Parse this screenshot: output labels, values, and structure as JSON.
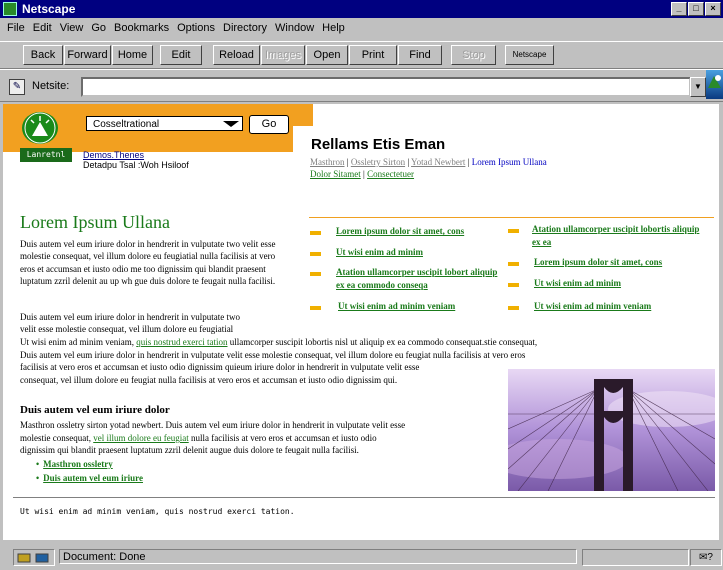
{
  "window": {
    "title": "Netscape"
  },
  "menu": [
    "File",
    "Edit",
    "View",
    "Go",
    "Bookmarks",
    "Options",
    "Directory",
    "Window",
    "Help"
  ],
  "toolbar": {
    "buttons": [
      "Back",
      "Forward",
      "Home",
      "Edit",
      "Reload",
      "Images",
      "Open",
      "Print",
      "Find",
      "Stop",
      "Netscape"
    ]
  },
  "location": {
    "label": "Netsite:",
    "value": ""
  },
  "banner": {
    "badge": "Lanretnl",
    "select_value": "Cosseltrational",
    "go_label": "Go",
    "demos_link": "Demos.Thenes",
    "demos_sub": "Detadpu Tsal :Woh Hsiloof"
  },
  "related": {
    "title": "Rellams Etis Eman",
    "links": [
      "Masthron",
      "Ossletry Sirton",
      "Yotad Newbert",
      "Lorem Ipsum Ullana",
      "Dolor Sitamet",
      "Consectetuer"
    ]
  },
  "main": {
    "heading": "Lorem Ipsum Ullana",
    "p1": "Duis autem vel eum iriure dolor in hendrerit in vulputate two velit esse molestie consequat, vel illum dolore eu feugiatial nulla facilisis at vero eros et accumsan et iusto odio me too dignissim qui blandit praesent luptatum zzril delenit au up wh gue duis dolore te feugait nulla facilisi.",
    "p2_line1": "Duis autem vel eum iriure dolor in hendrerit in vulputate two",
    "p2_line2": "velit esse molestie consequat, vel illum dolore eu feugiatial",
    "p2_line3_pre": "Ut wisi enim ad minim veniam,",
    "p2_link": "quis nostrud exerci tation",
    "p2_line3_post": "ullamcorper suscipit lobortis nisl ut aliquip ex ea commodo consequat.stie consequat,",
    "p2_line4": "Duis autem vel eum iriure dolor in hendrerit in vulputate velit esse molestie consequat, vel illum dolore eu feugiat nulla facilisis at vero eros",
    "p2_line5": "facilisis at vero eros et accumsan et iusto odio dignissim quieum iriure dolor in hendrerit in vulputate velit esse",
    "p2_line6": "consequat, vel illum dolore eu feugiat nulla facilisis at vero eros et accumsan et iusto odio dignissim qui.",
    "subheading": "Duis autem vel eum iriure dolor",
    "p3_line1": "Masthron ossletry sirton yotad newbert. Duis autem vel eum iriure dolor in hendrerit in vulputate velit esse",
    "p3_pre": "molestie consequat,",
    "p3_link": "vel illum dolore eu feugiat",
    "p3_post": "nulla facilisis at vero eros et accumsan et iusto odio",
    "p3_line3": "dignissim qui blandit praesent luptatum zzril delenit augue duis dolore te feugait nulla facilisi.",
    "green_links": [
      "Masthron ossletry",
      "Duis autem vel eum iriure"
    ]
  },
  "bullets_left": [
    "Lorem ipsum dolor sit amet, cons",
    "Ut wisi enim ad minim",
    "Atation ullamcorper uscipit lobort aliquip ex ea commodo conseqa",
    "Ut wisi enim ad minim veniam"
  ],
  "bullets_right": [
    "Atation ullamcorper uscipit lobortis aliquip ex ea",
    "Lorem ipsum dolor sit amet, cons",
    "Ut wisi enim ad minim",
    "Ut wisi enim ad minim veniam"
  ],
  "footer": "Ut wisi enim ad minim veniam, quis nostrud exerci tation.",
  "status": {
    "text": "Document: Done"
  },
  "colors": {
    "title_bar": "#000080",
    "banner": "#f2a020",
    "green": "#1a7a1a"
  }
}
